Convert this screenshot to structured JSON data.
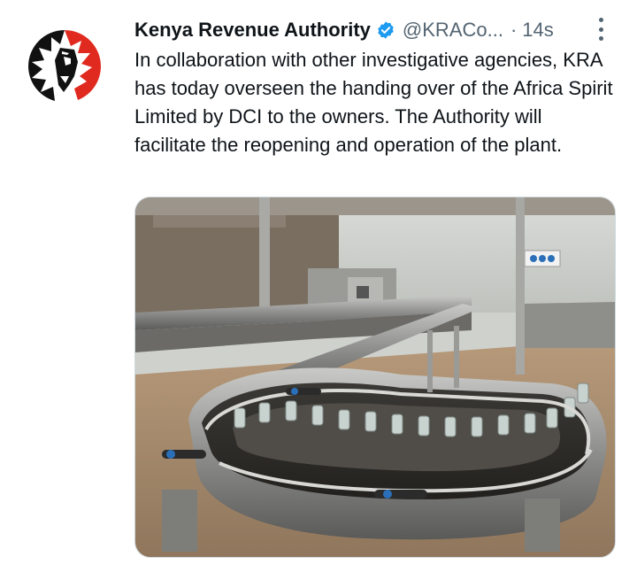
{
  "tweet": {
    "author_name": "Kenya Revenue Authority",
    "handle": "@KRACo...",
    "separator": "·",
    "time": "14s",
    "text": "In collaboration with other investigative agencies, KRA has today overseen the handing over of the Africa Spirit Limited by DCI to the owners. The Authority will facilitate the reopening and operation of the plant.",
    "verified": true,
    "icons": {
      "avatar": "kra-lion-logo",
      "verified": "verified-badge-icon",
      "more": "more-options-icon"
    },
    "colors": {
      "verified_badge": "#1d9bf0",
      "logo_red": "#e02a20",
      "logo_black": "#111111",
      "secondary_text": "#536471"
    },
    "media": {
      "description_icon": "factory-bottle-conveyor-photo"
    }
  }
}
